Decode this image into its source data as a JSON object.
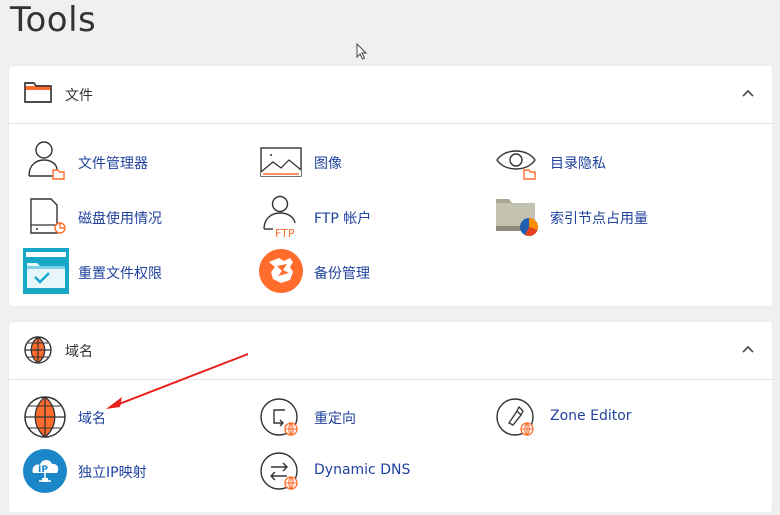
{
  "page": {
    "title": "Tools"
  },
  "sections": {
    "files": {
      "title": "文件",
      "items": [
        {
          "label": "文件管理器"
        },
        {
          "label": "图像"
        },
        {
          "label": "目录隐私"
        },
        {
          "label": "磁盘使用情况"
        },
        {
          "label": "FTP 帐户"
        },
        {
          "label": "索引节点占用量"
        },
        {
          "label": "重置文件权限"
        },
        {
          "label": "备份管理"
        }
      ]
    },
    "domains": {
      "title": "域名",
      "items": [
        {
          "label": "域名"
        },
        {
          "label": "重定向"
        },
        {
          "label": "Zone Editor"
        },
        {
          "label": "独立IP映射"
        },
        {
          "label": "Dynamic DNS"
        }
      ]
    }
  },
  "icons": {
    "ftp_text": "FTP",
    "ip_text": "IP"
  },
  "colors": {
    "accent_orange": "#ff6c2c",
    "link_blue": "#21439e",
    "annotation_red": "#e8201c",
    "ip_blue": "#1b86c8",
    "teal": "#17a8c8"
  }
}
